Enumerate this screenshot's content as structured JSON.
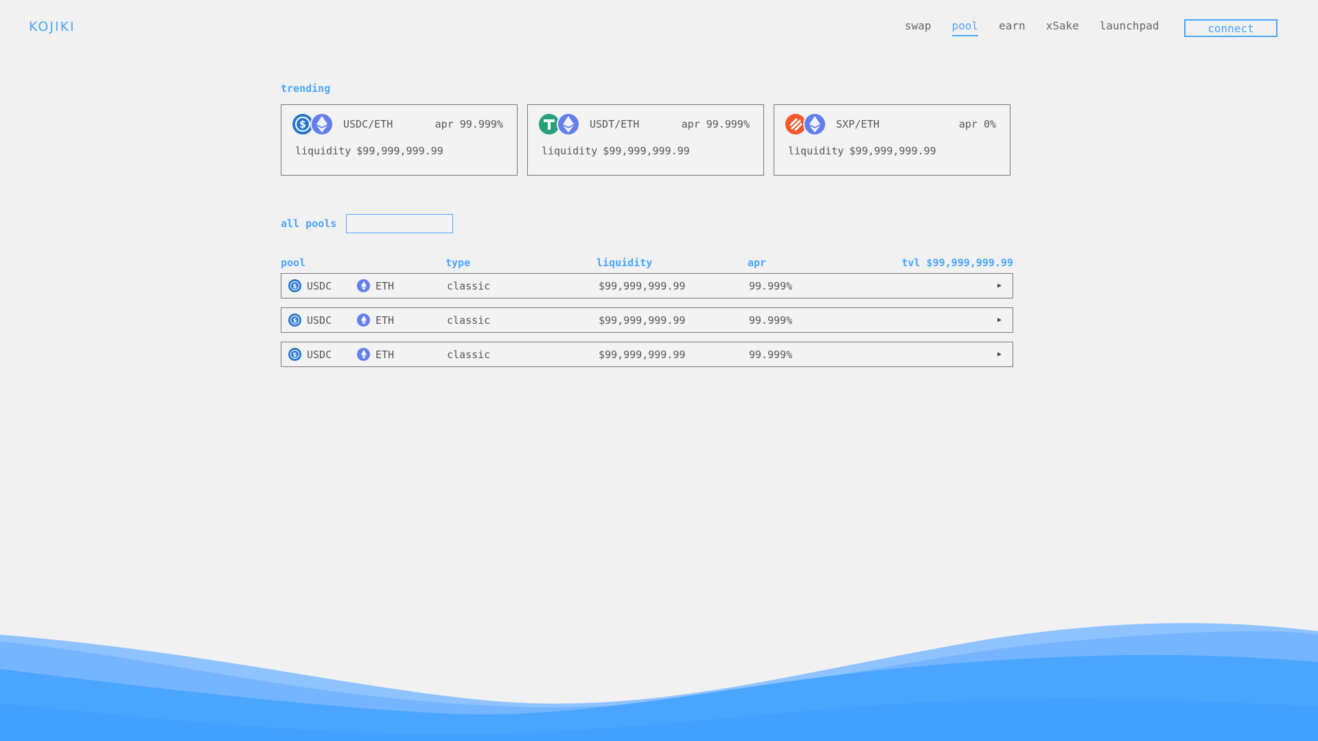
{
  "header": {
    "logo": "KOJIKI",
    "nav": [
      {
        "label": "swap",
        "active": false
      },
      {
        "label": "pool",
        "active": true
      },
      {
        "label": "earn",
        "active": false
      },
      {
        "label": "xSake",
        "active": false
      },
      {
        "label": "launchpad",
        "active": false
      }
    ],
    "connect_label": "connect"
  },
  "trending": {
    "label": "trending",
    "cards": [
      {
        "pair": "USDC/ETH",
        "apr_label": "apr",
        "apr": "99.999%",
        "liquidity_label": "liquidity",
        "liquidity": "$99,999,999.99",
        "icons": [
          "usdc-icon",
          "eth-icon"
        ]
      },
      {
        "pair": "USDT/ETH",
        "apr_label": "apr",
        "apr": "99.999%",
        "liquidity_label": "liquidity",
        "liquidity": "$99,999,999.99",
        "icons": [
          "usdt-icon",
          "eth-icon"
        ]
      },
      {
        "pair": "SXP/ETH",
        "apr_label": "apr",
        "apr": "0%",
        "liquidity_label": "liquidity",
        "liquidity": "$99,999,999.99",
        "icons": [
          "sxp-icon",
          "eth-icon"
        ]
      }
    ]
  },
  "all_pools": {
    "label": "all pools",
    "search_placeholder": "",
    "columns": {
      "pool": "pool",
      "type": "type",
      "liquidity": "liquidity",
      "apr": "apr",
      "tvl": "tvl $99,999,999.99"
    },
    "rows": [
      {
        "token0": "USDC",
        "token1": "ETH",
        "type": "classic",
        "liquidity": "$99,999,999.99",
        "apr": "99.999%"
      },
      {
        "token0": "USDC",
        "token1": "ETH",
        "type": "classic",
        "liquidity": "$99,999,999.99",
        "apr": "99.999%"
      },
      {
        "token0": "USDC",
        "token1": "ETH",
        "type": "classic",
        "liquidity": "$99,999,999.99",
        "apr": "99.999%"
      }
    ]
  },
  "colors": {
    "accent": "#4aa5ff",
    "background": "#f1f1f1",
    "usdc": "#2775ca",
    "usdt": "#26a17b",
    "sxp": "#f5592b",
    "eth": "#627eea"
  }
}
